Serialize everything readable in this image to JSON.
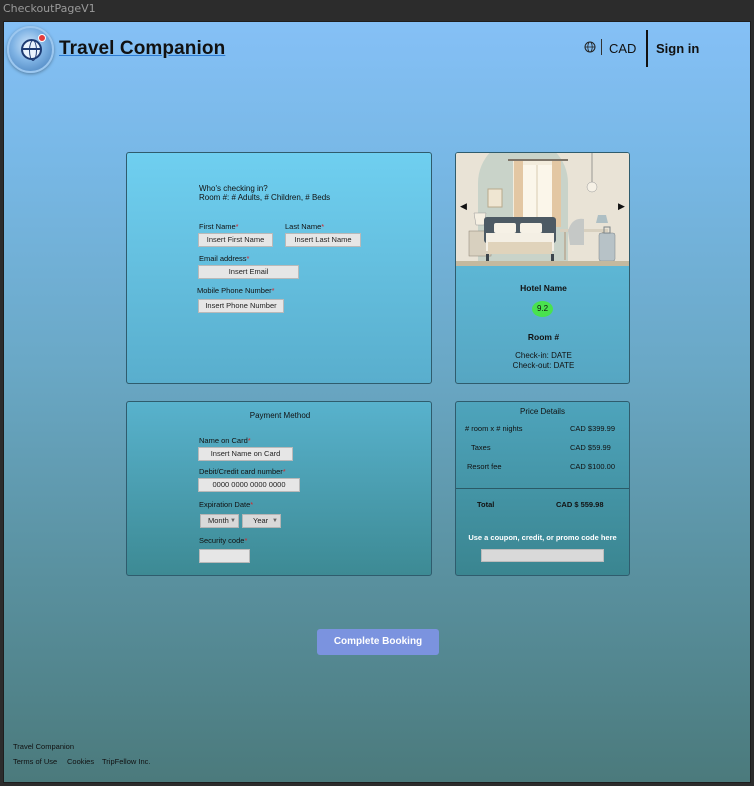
{
  "frame": {
    "label": "CheckoutPageV1"
  },
  "header": {
    "title": "Travel Companion",
    "currency": "CAD",
    "sign_in": "Sign in"
  },
  "guest": {
    "heading": "Who's checking in?",
    "subheading": "Room #: # Adults, # Children, # Beds",
    "first_name_label": "First Name",
    "first_name_value": "Insert First Name",
    "last_name_label": "Last Name",
    "last_name_value": "Insert Last Name",
    "email_label": "Email address",
    "email_value": "Insert Email",
    "phone_label": "Mobile Phone Number",
    "phone_value": "Insert Phone Number",
    "required_mark": "*"
  },
  "hotel": {
    "name": "Hotel Name",
    "rating": "9.2",
    "room": "Room #",
    "check_in": "Check-in: DATE",
    "check_out": "Check-out: DATE",
    "prev_arrow": "◀",
    "next_arrow": "▶"
  },
  "payment": {
    "heading": "Payment Method",
    "name_label": "Name on Card",
    "name_value": "Insert Name on Card",
    "card_label": "Debit/Credit card number",
    "card_value": "0000 0000 0000 0000",
    "exp_label": "Expiration Date",
    "month": "Month",
    "year": "Year",
    "security_label": "Security code",
    "security_value": ""
  },
  "price": {
    "heading": "Price Details",
    "rows": [
      {
        "label": "# room x # nights",
        "value": "CAD $399.99"
      },
      {
        "label": "Taxes",
        "value": "CAD $59.99"
      },
      {
        "label": "Resort fee",
        "value": "CAD $100.00"
      }
    ],
    "total_label": "Total",
    "total_value": "CAD $ 559.98",
    "coupon_label": "Use a coupon, credit, or promo code here",
    "coupon_value": ""
  },
  "actions": {
    "complete": "Complete Booking"
  },
  "footer": {
    "brand": "Travel Companion",
    "links": [
      "Terms of Use",
      "Cookies",
      "TripFellow Inc."
    ]
  }
}
